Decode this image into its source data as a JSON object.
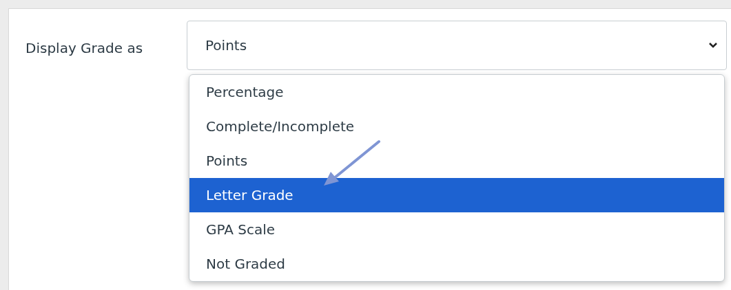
{
  "label": "Display Grade as",
  "select": {
    "value": "Points"
  },
  "options": [
    {
      "label": "Percentage",
      "selected": false
    },
    {
      "label": "Complete/Incomplete",
      "selected": false
    },
    {
      "label": "Points",
      "selected": false
    },
    {
      "label": "Letter Grade",
      "selected": true
    },
    {
      "label": "GPA Scale",
      "selected": false
    },
    {
      "label": "Not Graded",
      "selected": false
    }
  ]
}
